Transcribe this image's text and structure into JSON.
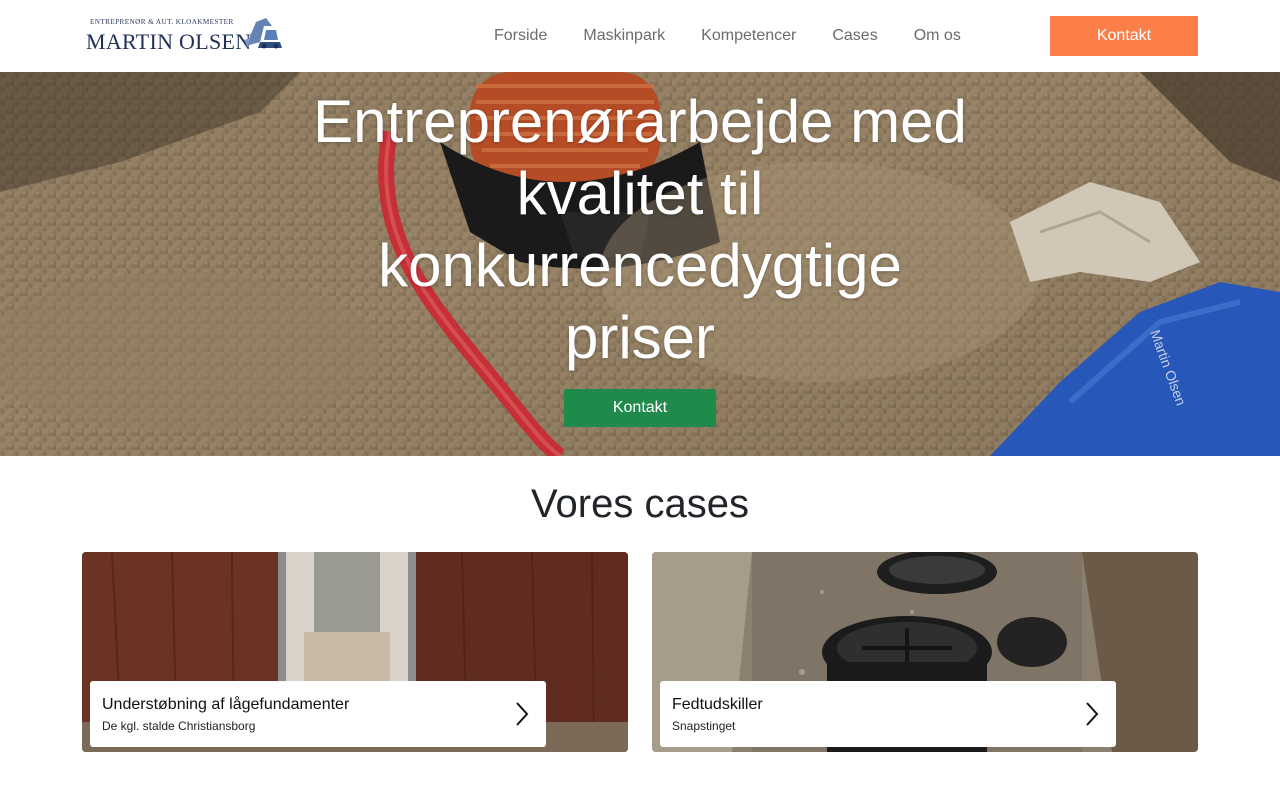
{
  "header": {
    "logo": {
      "small_text": "ENTREPRENØR & AUT. KLOAKMESTER",
      "name": "MARTIN OLSEN"
    },
    "nav": [
      "Forside",
      "Maskinpark",
      "Kompetencer",
      "Cases",
      "Om os"
    ],
    "cta_label": "Kontakt"
  },
  "hero": {
    "title": "Entreprenørarbejde med kvalitet til konkurrencedygtige priser",
    "cta_label": "Kontakt"
  },
  "cases": {
    "title": "Vores cases",
    "items": [
      {
        "title": "Understøbning af lågefundamenter",
        "subtitle": "De kgl. stalde Christiansborg",
        "icon": "chevron-right-icon"
      },
      {
        "title": "Fedtudskiller",
        "subtitle": "Snapstinget",
        "icon": "chevron-right-icon"
      }
    ]
  },
  "colors": {
    "header_cta": "#fc7f4a",
    "hero_cta": "#1f8a4c",
    "nav_text": "#6c6c6c",
    "brand_navy": "#1f2f57"
  }
}
